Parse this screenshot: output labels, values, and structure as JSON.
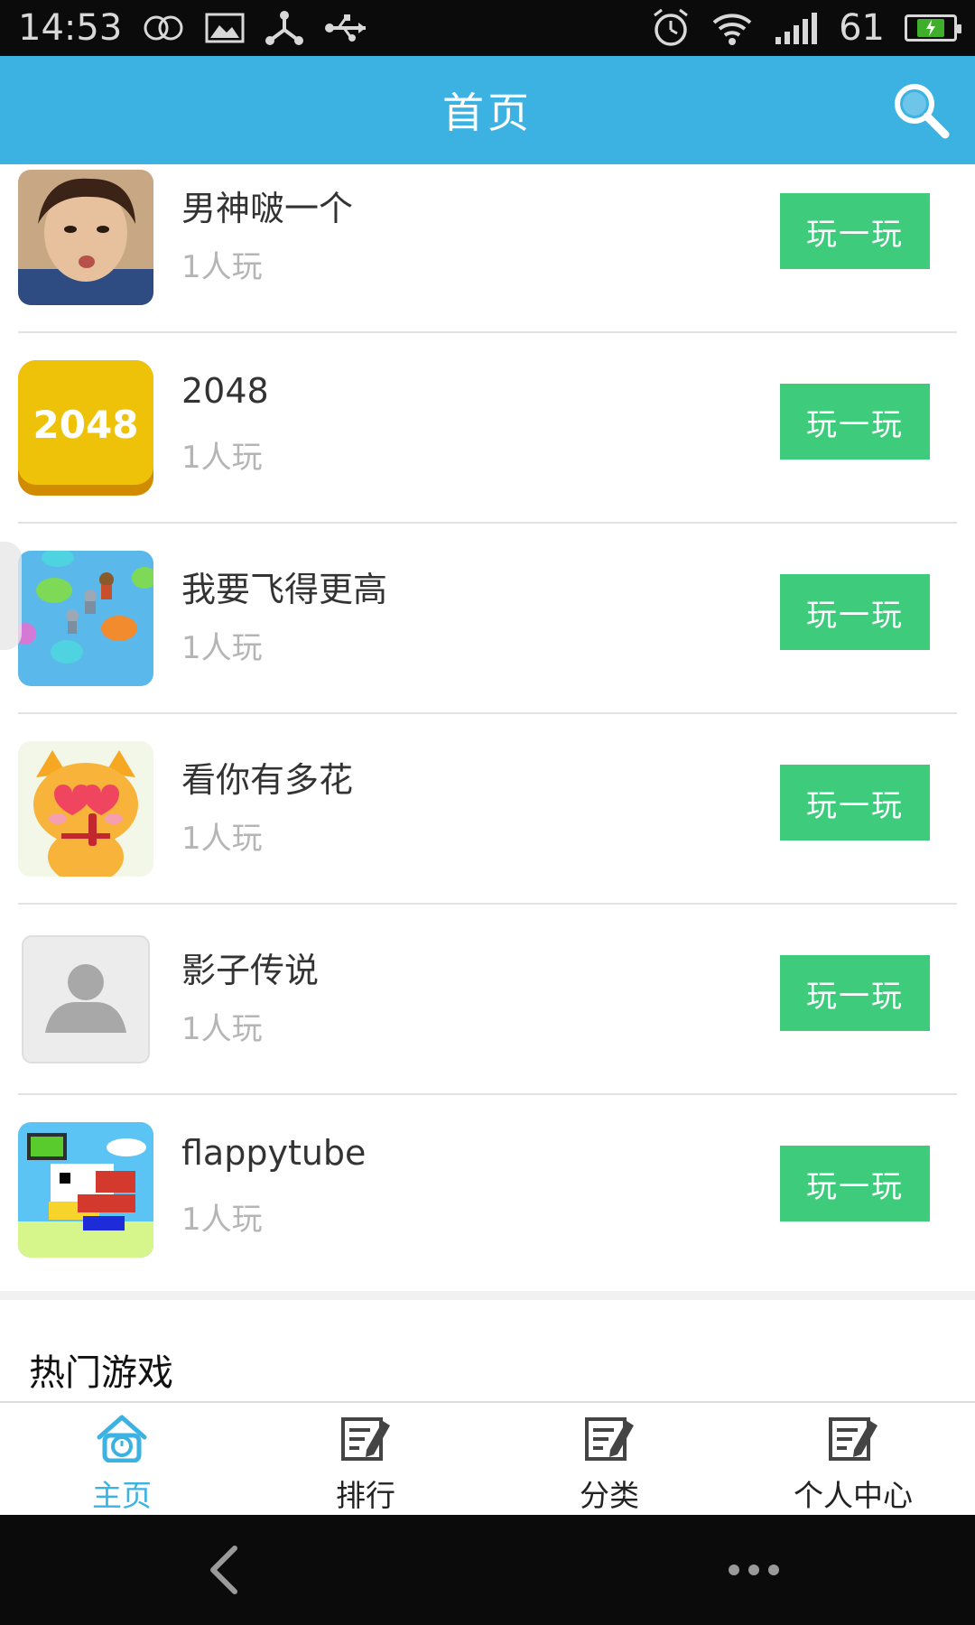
{
  "status_bar": {
    "time": "14:53",
    "battery_level": "61",
    "icons": [
      "link-icon",
      "image-icon",
      "share-icon",
      "usb-icon",
      "alarm-icon",
      "wifi-icon",
      "signal-icon",
      "battery-icon"
    ],
    "battery_color": "#3fae2a"
  },
  "app_bar": {
    "title": "首页",
    "search_icon": "search-icon",
    "color": "#3cb2e2"
  },
  "games": [
    {
      "name": "男神啵一个",
      "players": "1人玩",
      "button": "玩一玩",
      "thumb": "face-photo"
    },
    {
      "name": "2048",
      "players": "1人玩",
      "button": "玩一玩",
      "thumb": "2048-logo",
      "thumb_text": "2048"
    },
    {
      "name": "我要飞得更高",
      "players": "1人玩",
      "button": "玩一玩",
      "thumb": "sky-jump"
    },
    {
      "name": "看你有多花",
      "players": "1人玩",
      "button": "玩一玩",
      "thumb": "cartoon-cat"
    },
    {
      "name": "影子传说",
      "players": "1人玩",
      "button": "玩一玩",
      "thumb": "placeholder-avatar"
    },
    {
      "name": "flappytube",
      "players": "1人玩",
      "button": "玩一玩",
      "thumb": "flappy-bird"
    }
  ],
  "section": {
    "title": "热门游戏"
  },
  "bottom_nav": [
    {
      "label": "主页",
      "icon": "home-clock-icon",
      "active": true
    },
    {
      "label": "排行",
      "icon": "edit-note-icon",
      "active": false
    },
    {
      "label": "分类",
      "icon": "edit-note-icon",
      "active": false
    },
    {
      "label": "个人中心",
      "icon": "edit-note-icon",
      "active": false
    }
  ],
  "colors": {
    "accent": "#3cb2e2",
    "play_button": "#3ecb7c",
    "muted_text": "#b5b5b5"
  },
  "system_nav": {
    "back_icon": "back-chevron-icon",
    "more_icon": "more-dots-icon"
  }
}
